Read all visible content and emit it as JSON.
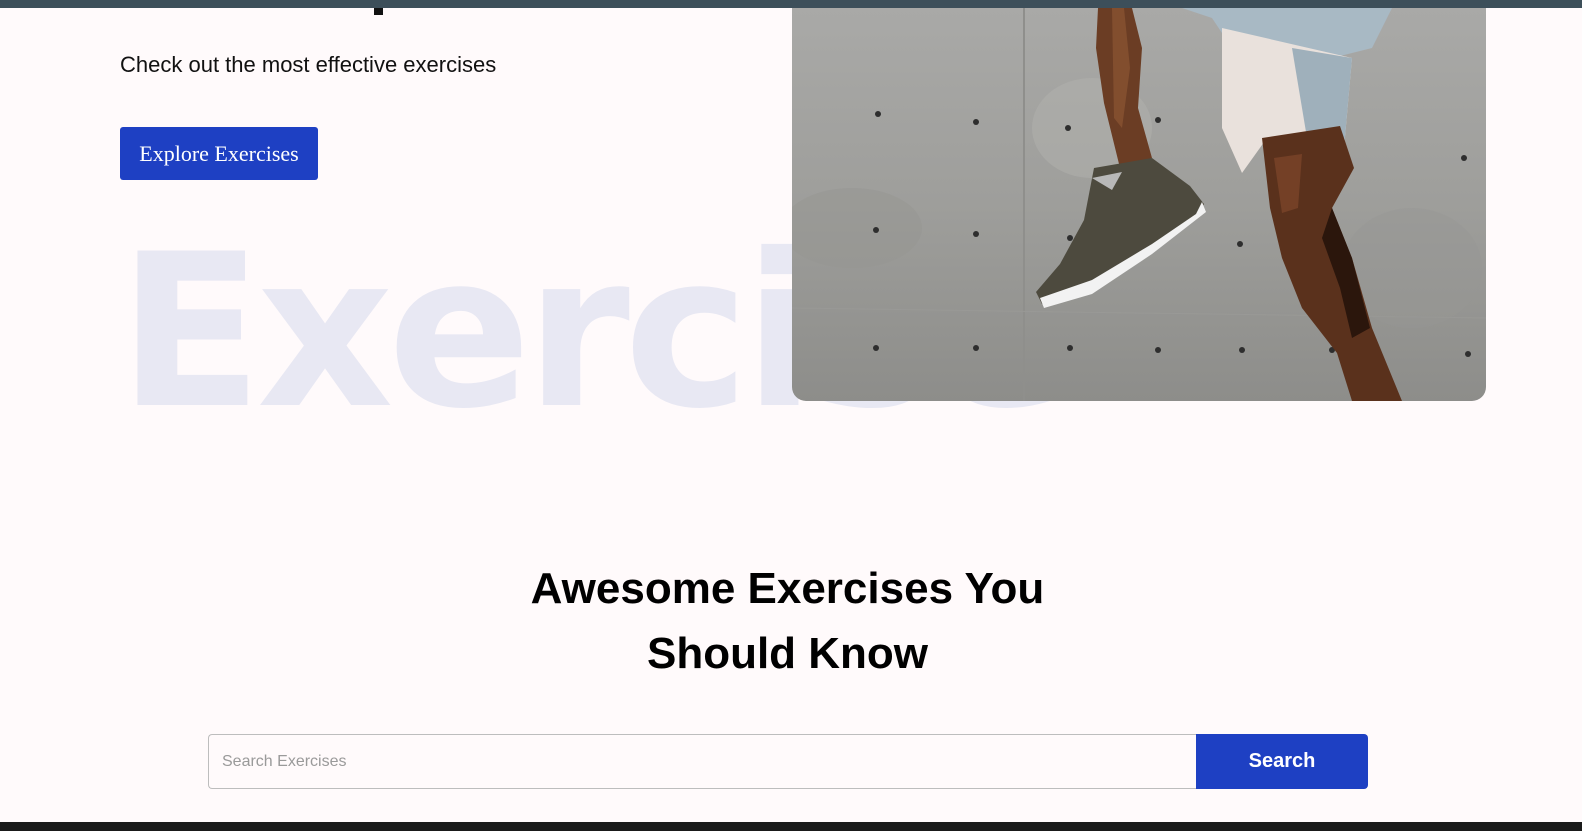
{
  "hero": {
    "subtitle": "Check out the most effective exercises",
    "explore_button_label": "Explore Exercises",
    "watermark_text": "Exercise",
    "image_alt": "athlete jumping in sneakers against concrete wall"
  },
  "exercises_section": {
    "title_line1": "Awesome Exercises You",
    "title_line2": "Should Know"
  },
  "search": {
    "placeholder": "Search Exercises",
    "value": "",
    "button_label": "Search"
  },
  "colors": {
    "page_background": "#fffafb",
    "accent": "#1e40c3",
    "watermark": "#e8e8f3",
    "top_bar": "#3d4f5a"
  }
}
